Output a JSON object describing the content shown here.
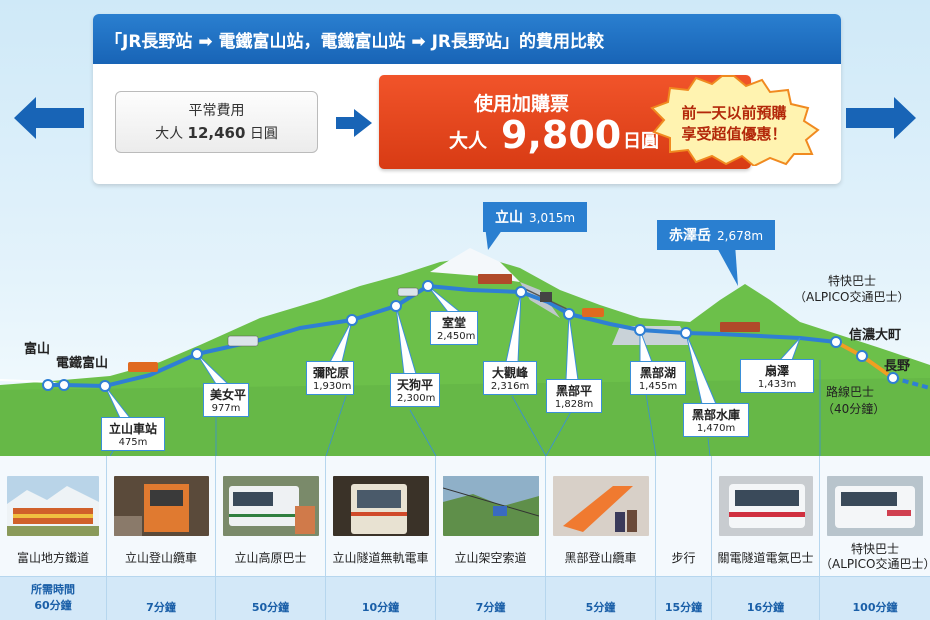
{
  "header": {
    "title": "「JR長野站 ➡ 電鐵富山站，電鐵富山站 ➡ JR長野站」的費用比較"
  },
  "normal_fare": {
    "title": "平常費用",
    "adult_label": "大人",
    "price": "12,460",
    "unit": "日圓"
  },
  "promo": {
    "title": "使用加購票",
    "adult_label": "大人",
    "price": "9,800",
    "unit": "日圓"
  },
  "badge": {
    "line1": "前一天以前預購",
    "line2": "享受超值優惠！"
  },
  "peaks": [
    {
      "name": "立山",
      "elevation": "3,015m"
    },
    {
      "name": "赤澤岳",
      "elevation": "2,678m"
    }
  ],
  "cities": {
    "toyama": "富山",
    "dentetsu_toyama": "電鐵富山",
    "shinano_omachi": "信濃大町",
    "nagano": "長野",
    "express_bus": "特快巴士",
    "alpico": "（ALPICO交通巴士）",
    "route_bus": "路線巴士",
    "route_bus_time": "（40分鐘）"
  },
  "stations": [
    {
      "name": "立山車站",
      "elevation": "475m"
    },
    {
      "name": "美女平",
      "elevation": "977m"
    },
    {
      "name": "彌陀原",
      "elevation": "1,930m"
    },
    {
      "name": "天狗平",
      "elevation": "2,300m"
    },
    {
      "name": "室堂",
      "elevation": "2,450m"
    },
    {
      "name": "大觀峰",
      "elevation": "2,316m"
    },
    {
      "name": "黑部平",
      "elevation": "1,828m"
    },
    {
      "name": "黑部湖",
      "elevation": "1,455m"
    },
    {
      "name": "黑部水庫",
      "elevation": "1,470m"
    },
    {
      "name": "扇澤",
      "elevation": "1,433m"
    }
  ],
  "transport": [
    {
      "label": "富山地方鐵道",
      "time": "60分鐘",
      "time_title": "所需時間"
    },
    {
      "label": "立山登山纜車",
      "time": "7分鐘"
    },
    {
      "label": "立山高原巴士",
      "time": "50分鐘"
    },
    {
      "label": "立山隧道無軌電車",
      "time": "10分鐘"
    },
    {
      "label": "立山架空索道",
      "time": "7分鐘"
    },
    {
      "label": "黑部登山纜車",
      "time": "5分鐘"
    },
    {
      "label": "步行",
      "time": "15分鐘"
    },
    {
      "label": "關電隧道電氣巴士",
      "time": "16分鐘"
    },
    {
      "label": "特快巴士",
      "label2": "（ALPICO交通巴士）",
      "time": "100分鐘"
    }
  ],
  "colors": {
    "accent_blue": "#1864b6",
    "promo_red": "#e04a1c",
    "mountain_green": "#6cc04a",
    "route_blue": "#2f7fd4",
    "bus_orange": "#f0a020"
  }
}
